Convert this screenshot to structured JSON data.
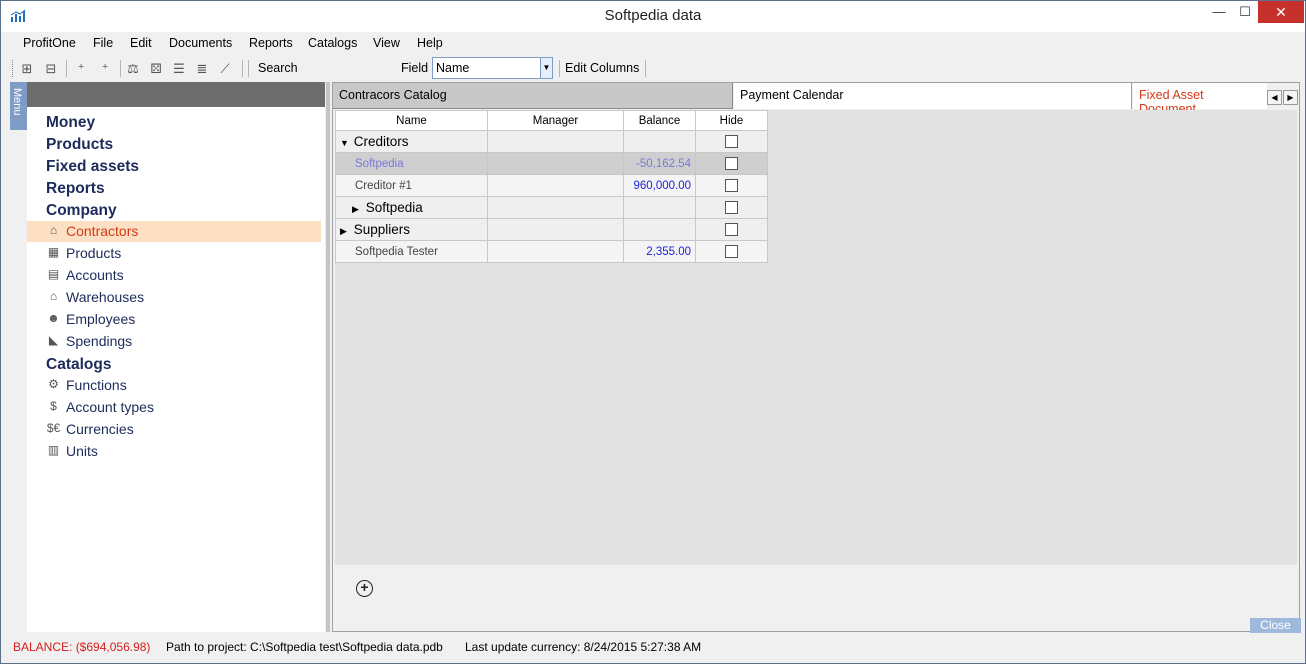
{
  "window": {
    "title": "Softpedia data",
    "minimize": "—",
    "maximize": "☐",
    "close": "✕"
  },
  "menubar": [
    "ProfitOne",
    "File",
    "Edit",
    "Documents",
    "Reports",
    "Catalogs",
    "View",
    "Help"
  ],
  "toolbar": {
    "search_label": "Search",
    "field_label": "Field",
    "field_value": "Name",
    "edit_columns": "Edit Columns"
  },
  "sidebar": {
    "menu_tab": "Menu",
    "sections": [
      {
        "label": "Money"
      },
      {
        "label": "Products"
      },
      {
        "label": "Fixed assets"
      },
      {
        "label": "Reports"
      },
      {
        "label": "Company"
      }
    ],
    "company_items": [
      {
        "label": "Contractors",
        "icon": "contractors-icon",
        "selected": true
      },
      {
        "label": "Products",
        "icon": "products-icon"
      },
      {
        "label": "Accounts",
        "icon": "accounts-icon"
      },
      {
        "label": "Warehouses",
        "icon": "warehouses-icon"
      },
      {
        "label": "Employees",
        "icon": "employees-icon"
      },
      {
        "label": "Spendings",
        "icon": "spendings-icon"
      }
    ],
    "catalogs_label": "Catalogs",
    "catalog_items": [
      {
        "label": "Functions",
        "icon": "functions-icon"
      },
      {
        "label": "Account types",
        "icon": "account-types-icon"
      },
      {
        "label": "Currencies",
        "icon": "currencies-icon"
      },
      {
        "label": "Units",
        "icon": "units-icon"
      }
    ]
  },
  "tabs": [
    {
      "label": "Contracors Catalog",
      "active": true
    },
    {
      "label": "Payment Calendar"
    },
    {
      "label": "Fixed Asset Document"
    }
  ],
  "grid": {
    "columns": [
      "Name",
      "Manager",
      "Balance",
      "Hide"
    ],
    "rows": [
      {
        "name": "Creditors",
        "manager": "",
        "balance": "",
        "group": true,
        "expanded": true
      },
      {
        "name": "Softpedia",
        "manager": "",
        "balance": "-50,162.54",
        "selected": true
      },
      {
        "name": "Creditor #1",
        "manager": "",
        "balance": "960,000.00"
      },
      {
        "name": "Softpedia",
        "manager": "",
        "balance": "",
        "group": true,
        "expanded": false,
        "indent": true
      },
      {
        "name": "Suppliers",
        "manager": "",
        "balance": "",
        "group": true,
        "expanded": false
      },
      {
        "name": "Softpedia Tester",
        "manager": "",
        "balance": "2,355.00"
      }
    ]
  },
  "close_label": "Close",
  "status": {
    "balance": "BALANCE: ($694,056.98)",
    "path": "Path to project: C:\\Softpedia test\\Softpedia data.pdb",
    "last_update": "Last update currency: 8/24/2015 5:27:38 AM"
  }
}
